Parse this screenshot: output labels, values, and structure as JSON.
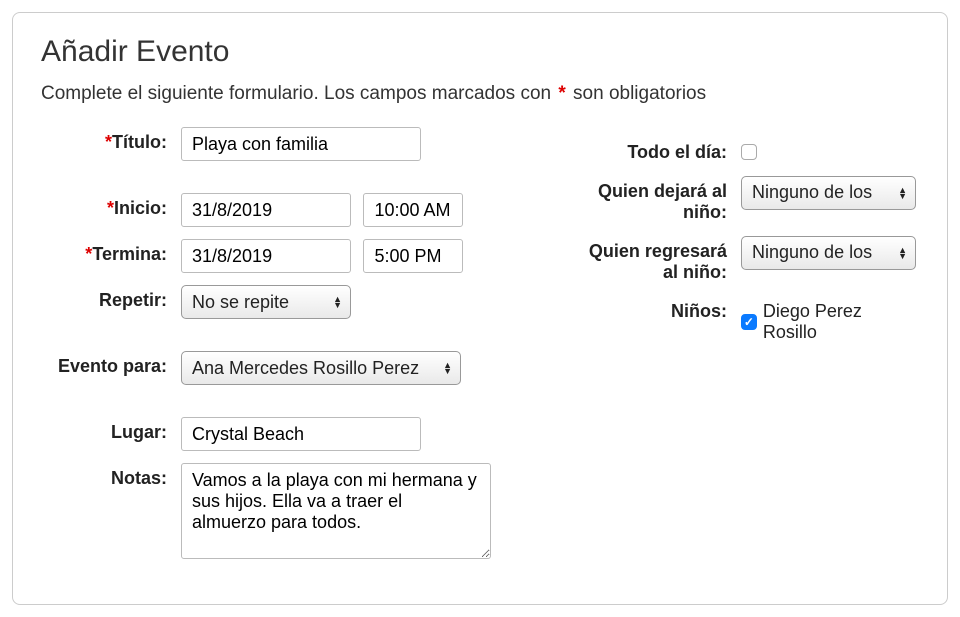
{
  "heading": "Añadir Evento",
  "subtitle_part1": "Complete el siguiente formulario. Los campos marcados con ",
  "subtitle_part2": " son obligatorios",
  "labels": {
    "title": "Título:",
    "start": "Inicio:",
    "end": "Termina:",
    "repeat": "Repetir:",
    "event_for": "Evento para:",
    "place": "Lugar:",
    "notes": "Notas:",
    "all_day": "Todo el día:",
    "dropoff": "Quien dejará al niño:",
    "pickup": "Quien regresará al niño:",
    "children": "Niños:"
  },
  "values": {
    "title": "Playa con familia",
    "start_date": "31/8/2019",
    "start_time": "10:00 AM",
    "end_date": "31/8/2019",
    "end_time": "5:00 PM",
    "repeat": "No se repite",
    "event_for": "Ana Mercedes Rosillo Perez",
    "place": "Crystal Beach",
    "notes": "Vamos a la playa con mi hermana y sus hijos. Ella va a traer el almuerzo para todos.",
    "dropoff": "Ninguno de los",
    "pickup": "Ninguno de los",
    "child_name": "Diego Perez Rosillo"
  }
}
